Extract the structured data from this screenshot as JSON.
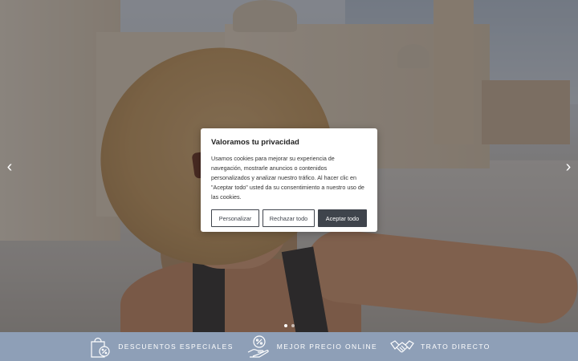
{
  "carousel": {
    "prev_icon": "chevron-left-icon",
    "next_icon": "chevron-right-icon",
    "prev_glyph": "‹",
    "next_glyph": "›"
  },
  "cookie_banner": {
    "title": "Valoramos tu privacidad",
    "text": "Usamos cookies para mejorar su experiencia de navegación, mostrarle anuncios o contenidos personalizados y analizar nuestro tráfico. Al hacer clic en \"Aceptar todo\" usted da su consentimiento a nuestro uso de las cookies.",
    "buttons": {
      "personalize": "Personalizar",
      "reject": "Rechazar todo",
      "accept": "Aceptar todo"
    }
  },
  "features": [
    {
      "icon": "shopping-bag-percent-icon",
      "label": "Descuentos especiales"
    },
    {
      "icon": "hand-percent-icon",
      "label": "Mejor precio online"
    },
    {
      "icon": "handshake-icon",
      "label": "Trato directo"
    }
  ],
  "colors": {
    "features_bar": "#8e9fb7",
    "button_dark": "#3f444c"
  }
}
